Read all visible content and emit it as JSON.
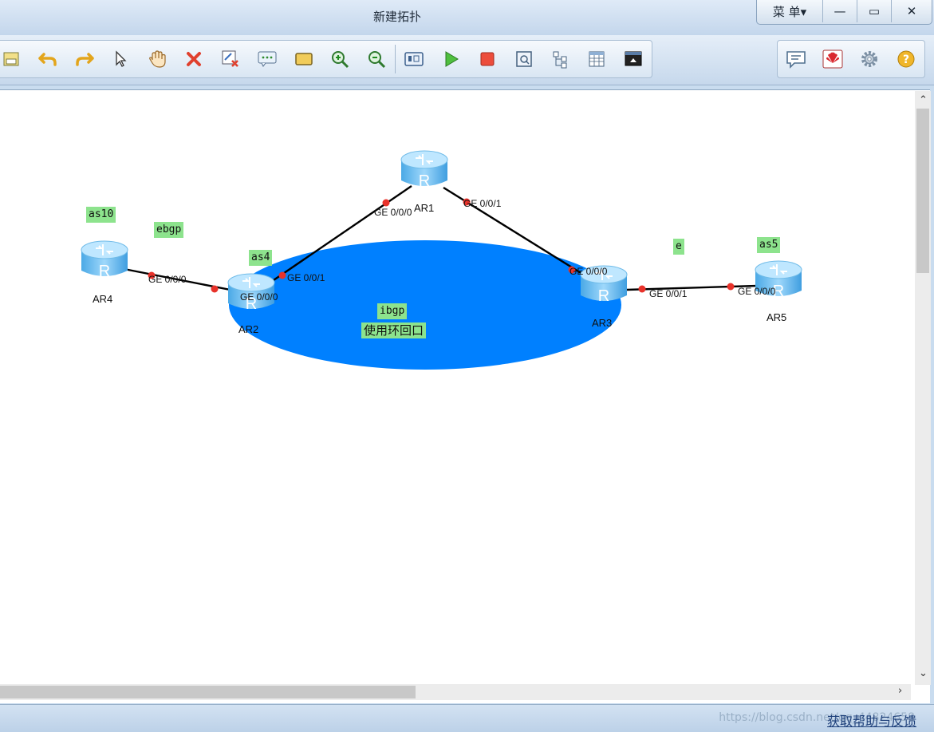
{
  "window": {
    "title": "新建拓扑",
    "menu_label": "菜 单▾",
    "minimize_glyph": "—",
    "maximize_glyph": "▭",
    "close_glyph": "✕"
  },
  "toolbar": {
    "left_tools": [
      "save-icon",
      "undo-icon",
      "redo-icon",
      "select-icon",
      "pan-hand-icon",
      "delete-icon",
      "clear-link-icon",
      "text-note-icon",
      "rectangle-icon",
      "zoom-in-icon",
      "zoom-out-icon",
      "interface-icon",
      "start-device-icon",
      "stop-device-icon",
      "capture-icon",
      "topology-icon",
      "grid-icon",
      "console-icon"
    ],
    "right_tools": [
      "chat-icon",
      "huawei-logo-icon",
      "settings-icon",
      "help-icon"
    ]
  },
  "topology": {
    "routers": [
      {
        "id": "ar1",
        "name": "AR1"
      },
      {
        "id": "ar2",
        "name": "AR2"
      },
      {
        "id": "ar3",
        "name": "AR3"
      },
      {
        "id": "ar4",
        "name": "AR4"
      },
      {
        "id": "ar5",
        "name": "AR5"
      }
    ],
    "notes": {
      "as10": "as10",
      "ebgp": "ebgp",
      "as4": "as4",
      "ibgp": "ibgp",
      "loopback": "使用环回口",
      "e": "e",
      "as5": "as5"
    },
    "ports": {
      "ar4_g000": "GE 0/0/0",
      "ar2_g000": "GE 0/0/0",
      "ar2_g001": "GE 0/0/1",
      "ar1_g000": "GE 0/0/0",
      "ar1_g001": "GE 0/0/1",
      "ar3_g000": "GE 0/0/0",
      "ar3_g001": "GE 0/0/1",
      "ar5_g000": "GE 0/0/0"
    },
    "area_color": "#0080ff",
    "link_color": "#000000",
    "port_dot_color": "#e8322a"
  },
  "statusbar": {
    "feedback_link": "获取帮助与反馈",
    "watermark": "https://blog.csdn.net/qq_44824658"
  }
}
